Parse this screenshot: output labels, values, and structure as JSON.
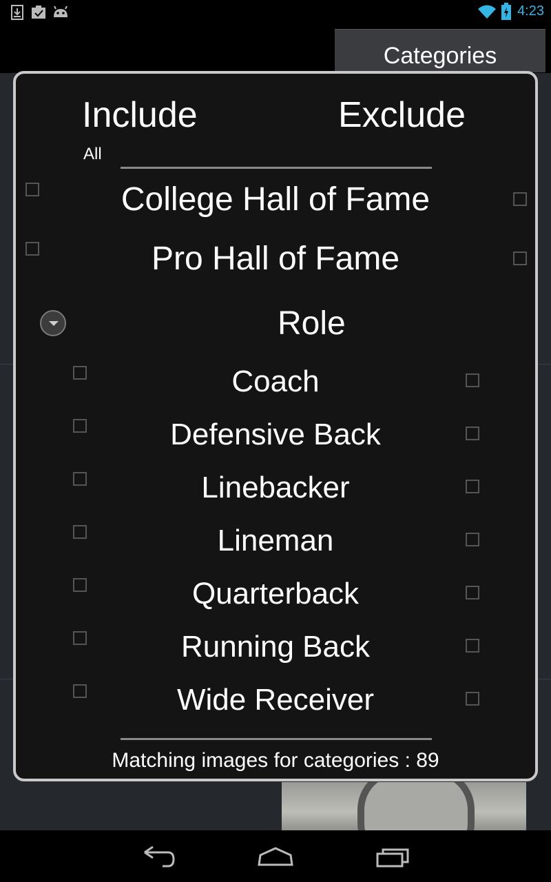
{
  "status_bar": {
    "time": "4:23",
    "accent_color": "#33b5e5",
    "icons": [
      "download-icon",
      "clipboard-icon",
      "android-icon",
      "wifi-icon",
      "battery-charging-icon"
    ]
  },
  "action_bar": {
    "categories_tab": "Categories"
  },
  "dialog": {
    "include_header": "Include",
    "exclude_header": "Exclude",
    "all_label": "All",
    "top_categories": [
      {
        "label": "College Hall of Fame",
        "include_checked": false,
        "exclude_checked": false
      },
      {
        "label": "Pro Hall of Fame",
        "include_checked": false,
        "exclude_checked": false
      }
    ],
    "group": {
      "label": "Role",
      "expanded": true,
      "items": [
        {
          "label": "Coach",
          "include_checked": false,
          "exclude_checked": false
        },
        {
          "label": "Defensive Back",
          "include_checked": false,
          "exclude_checked": false
        },
        {
          "label": "Linebacker",
          "include_checked": false,
          "exclude_checked": false
        },
        {
          "label": "Lineman",
          "include_checked": false,
          "exclude_checked": false
        },
        {
          "label": "Quarterback",
          "include_checked": false,
          "exclude_checked": false
        },
        {
          "label": "Running Back",
          "include_checked": false,
          "exclude_checked": false
        },
        {
          "label": "Wide Receiver",
          "include_checked": false,
          "exclude_checked": false
        }
      ]
    },
    "footer": "Matching images for categories : 89"
  },
  "nav_bar": {
    "buttons": [
      "back-icon",
      "home-icon",
      "recent-apps-icon"
    ]
  }
}
